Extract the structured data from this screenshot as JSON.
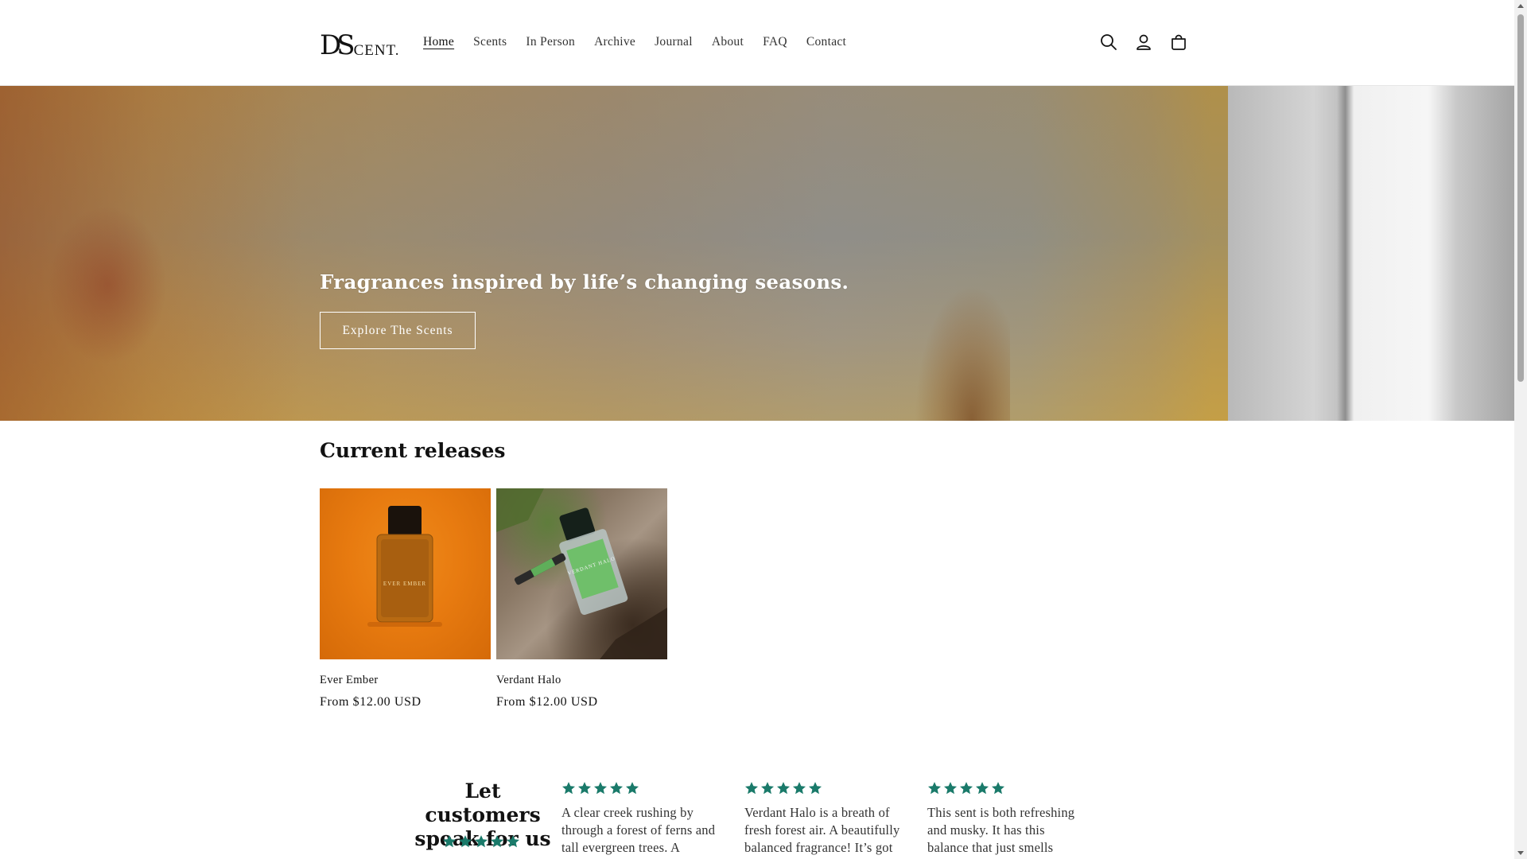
{
  "header": {
    "logo": {
      "big": "DS",
      "small": "CENT."
    },
    "nav": [
      {
        "label": "Home",
        "active": true
      },
      {
        "label": "Scents"
      },
      {
        "label": "In Person"
      },
      {
        "label": "Archive"
      },
      {
        "label": "Journal"
      },
      {
        "label": "About"
      },
      {
        "label": "FAQ"
      },
      {
        "label": "Contact"
      }
    ],
    "icons": [
      "search-icon",
      "account-icon",
      "cart-icon"
    ]
  },
  "hero": {
    "title": "Fragrances inspired by life’s changing seasons.",
    "button_label": "Explore The Scents"
  },
  "releases": {
    "title": "Current releases",
    "products": [
      {
        "name": "Ever Ember",
        "price": "From $12.00 USD",
        "bottle_label": "EVER EMBER"
      },
      {
        "name": "Verdant Halo",
        "price": "From $12.00 USD",
        "bottle_label": "VERDANT HALO"
      }
    ]
  },
  "reviews": {
    "title": "Let customers speak for us",
    "rating": 5,
    "items": [
      {
        "rating": 5,
        "text": "A clear creek rushing by through a forest of ferns and tall evergreen trees. A"
      },
      {
        "rating": 5,
        "text": "Verdant Halo is a breath of fresh forest air. A beautifully balanced fragrance! It’s got"
      },
      {
        "rating": 5,
        "text": "This sent is both refreshing and musky. It has this balance that just smells"
      }
    ]
  },
  "colors": {
    "star": "#1a7a6a",
    "text": "#121212",
    "ember_bg": "#e87b10",
    "halo_label": "#6fbf6a"
  }
}
